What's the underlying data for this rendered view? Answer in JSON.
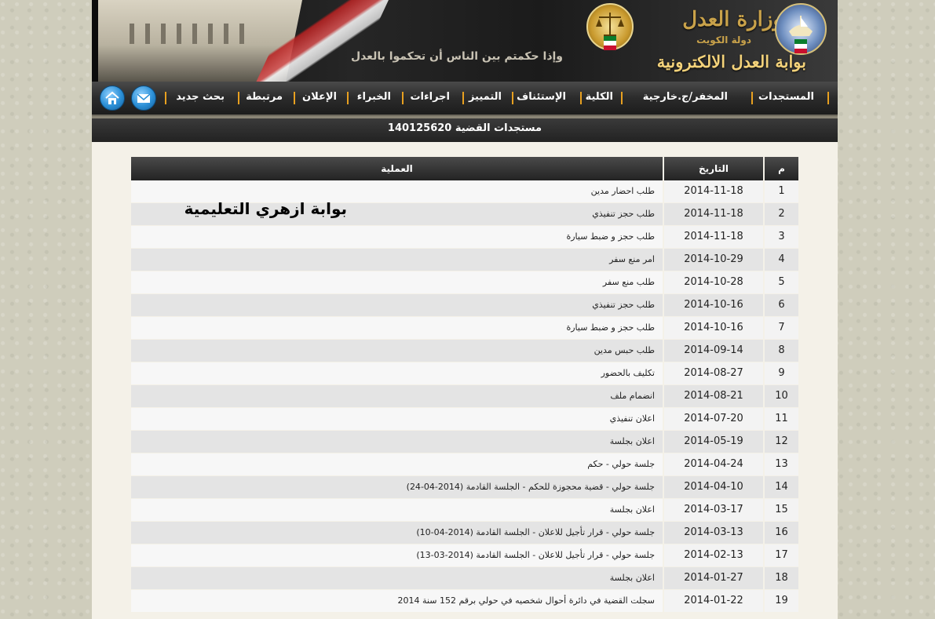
{
  "header": {
    "motto": "وإذا حكمتم بين الناس أن تحكموا بالعدل",
    "ministry": "وزارة العدل",
    "country": "دولة الكويت",
    "portal": "بوابة العدل الالكترونية"
  },
  "nav": {
    "items": [
      "المستجدات",
      "المخفر/ج.خارجية",
      "الكلية",
      "الإستئناف",
      "التمييز",
      "اجراءات",
      "الخبراء",
      "الإعلان",
      "مرتبطة",
      "بحث جديد"
    ],
    "icons": [
      "home-icon",
      "mail-icon"
    ]
  },
  "title": "مستجدات القضية 140125620",
  "table": {
    "headers": {
      "num": "م",
      "date": "التاريخ",
      "op": "العملية"
    },
    "rows": [
      {
        "num": "1",
        "date": "2014-11-18",
        "op": "طلب احضار مدين"
      },
      {
        "num": "2",
        "date": "2014-11-18",
        "op": "طلب حجز تنفيذي"
      },
      {
        "num": "3",
        "date": "2014-11-18",
        "op": "طلب حجز و ضبط سيارة"
      },
      {
        "num": "4",
        "date": "2014-10-29",
        "op": "امر منع سفر"
      },
      {
        "num": "5",
        "date": "2014-10-28",
        "op": "طلب منع سفر"
      },
      {
        "num": "6",
        "date": "2014-10-16",
        "op": "طلب حجز تنفيذي"
      },
      {
        "num": "7",
        "date": "2014-10-16",
        "op": "طلب حجز و ضبط سيارة"
      },
      {
        "num": "8",
        "date": "2014-09-14",
        "op": "طلب حبس مدين"
      },
      {
        "num": "9",
        "date": "2014-08-27",
        "op": "تكليف بالحضور"
      },
      {
        "num": "10",
        "date": "2014-08-21",
        "op": "انضمام ملف"
      },
      {
        "num": "11",
        "date": "2014-07-20",
        "op": "اعلان تنفيذي"
      },
      {
        "num": "12",
        "date": "2014-05-19",
        "op": "اعلان بجلسة"
      },
      {
        "num": "13",
        "date": "2014-04-24",
        "op": "جلسة حولي - حكم"
      },
      {
        "num": "14",
        "date": "2014-04-10",
        "op": "جلسة حولي - قضية محجوزة للحكم - الجلسة القادمة (2014-04-24)"
      },
      {
        "num": "15",
        "date": "2014-03-17",
        "op": "اعلان بجلسة"
      },
      {
        "num": "16",
        "date": "2014-03-13",
        "op": "جلسة حولي - قرار تأجيل للاعلان - الجلسة القادمة (2014-04-10)"
      },
      {
        "num": "17",
        "date": "2014-02-13",
        "op": "جلسة حولي - قرار تأجيل للاعلان - الجلسة القادمة (2014-03-13)"
      },
      {
        "num": "18",
        "date": "2014-01-27",
        "op": "اعلان بجلسة"
      },
      {
        "num": "19",
        "date": "2014-01-22",
        "op": "سجلت القضية في دائرة أحوال شخصيه في حولي برقم 152 سنة 2014"
      }
    ]
  },
  "watermark": "بوابة ازهري التعليمية",
  "colors": {
    "nav_separator": "#e8a020",
    "header_gold": "#c9a24a",
    "icon_blue": "#2b8fd6"
  }
}
